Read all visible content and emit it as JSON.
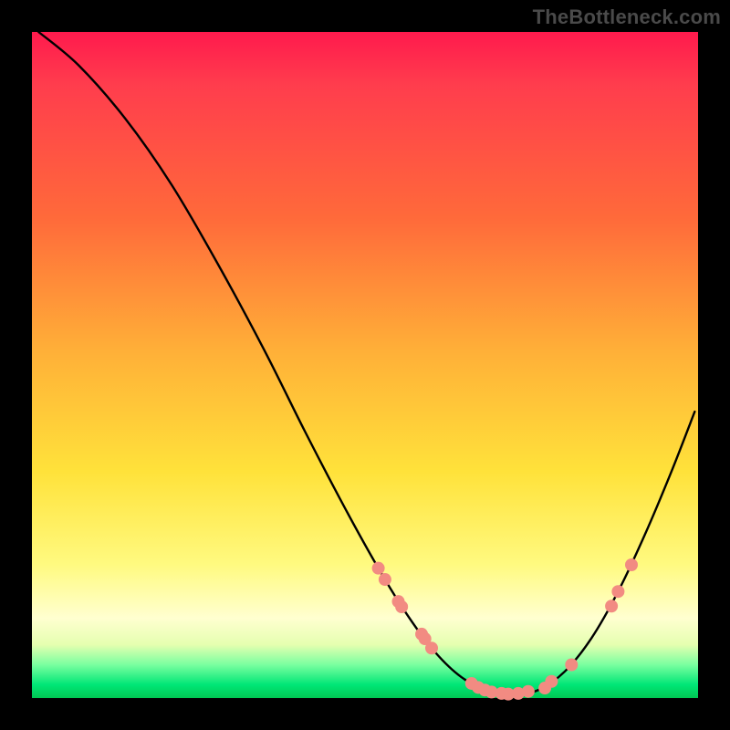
{
  "watermark": "TheBottleneck.com",
  "chart_data": {
    "type": "line",
    "title": "",
    "xlabel": "",
    "ylabel": "",
    "xlim": [
      0,
      1
    ],
    "ylim": [
      0,
      1
    ],
    "legend": false,
    "grid": false,
    "curve": [
      {
        "x": 0.01,
        "y": 1.0
      },
      {
        "x": 0.07,
        "y": 0.95
      },
      {
        "x": 0.14,
        "y": 0.87
      },
      {
        "x": 0.21,
        "y": 0.77
      },
      {
        "x": 0.28,
        "y": 0.65
      },
      {
        "x": 0.35,
        "y": 0.52
      },
      {
        "x": 0.41,
        "y": 0.4
      },
      {
        "x": 0.47,
        "y": 0.285
      },
      {
        "x": 0.52,
        "y": 0.195
      },
      {
        "x": 0.56,
        "y": 0.13
      },
      {
        "x": 0.6,
        "y": 0.075
      },
      {
        "x": 0.64,
        "y": 0.035
      },
      {
        "x": 0.68,
        "y": 0.012
      },
      {
        "x": 0.72,
        "y": 0.005
      },
      {
        "x": 0.76,
        "y": 0.012
      },
      {
        "x": 0.8,
        "y": 0.04
      },
      {
        "x": 0.84,
        "y": 0.09
      },
      {
        "x": 0.88,
        "y": 0.16
      },
      {
        "x": 0.92,
        "y": 0.245
      },
      {
        "x": 0.96,
        "y": 0.34
      },
      {
        "x": 0.995,
        "y": 0.43
      }
    ],
    "markers": [
      {
        "x": 0.52,
        "y": 0.195
      },
      {
        "x": 0.53,
        "y": 0.178
      },
      {
        "x": 0.55,
        "y": 0.145
      },
      {
        "x": 0.555,
        "y": 0.137
      },
      {
        "x": 0.585,
        "y": 0.096
      },
      {
        "x": 0.59,
        "y": 0.089
      },
      {
        "x": 0.6,
        "y": 0.075
      },
      {
        "x": 0.66,
        "y": 0.022
      },
      {
        "x": 0.67,
        "y": 0.016
      },
      {
        "x": 0.68,
        "y": 0.012
      },
      {
        "x": 0.69,
        "y": 0.009
      },
      {
        "x": 0.705,
        "y": 0.007
      },
      {
        "x": 0.715,
        "y": 0.006
      },
      {
        "x": 0.73,
        "y": 0.007
      },
      {
        "x": 0.745,
        "y": 0.01
      },
      {
        "x": 0.77,
        "y": 0.015
      },
      {
        "x": 0.78,
        "y": 0.025
      },
      {
        "x": 0.81,
        "y": 0.05
      },
      {
        "x": 0.87,
        "y": 0.138
      },
      {
        "x": 0.88,
        "y": 0.16
      },
      {
        "x": 0.9,
        "y": 0.2
      }
    ],
    "colors": {
      "curve": "#000000",
      "marker_fill": "#f28b82",
      "marker_stroke": "#f28b82"
    }
  }
}
